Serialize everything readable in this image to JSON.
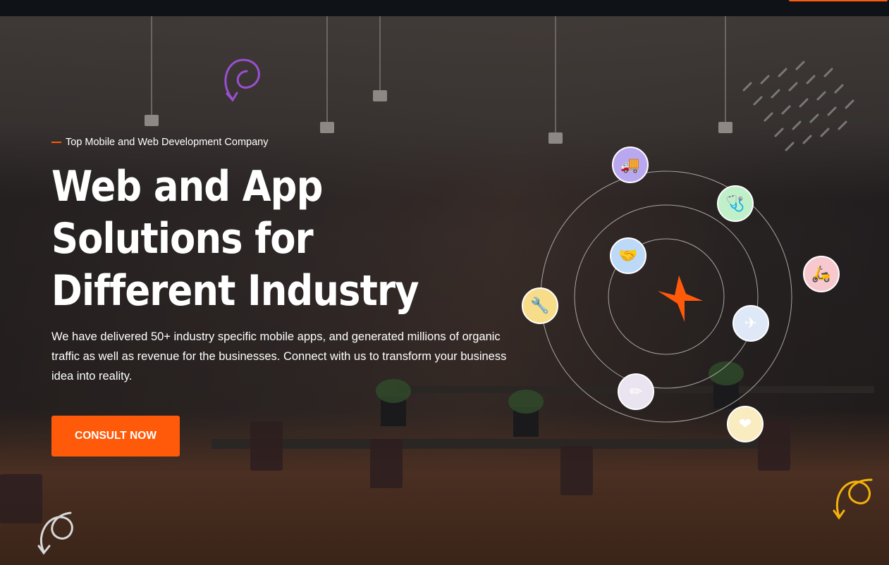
{
  "hero": {
    "eyebrow": "Top Mobile and Web Development Company",
    "title_lines": [
      "Web and App",
      "Solutions for",
      "Different Industry"
    ],
    "description": "We have delivered 50+ industry specific mobile apps, and generated millions of organic traffic as well as revenue for the businesses. Connect with us to transform your business idea into reality.",
    "cta_label": "CONSULT NOW"
  },
  "orbit": {
    "center_icon": "brand-x-icon",
    "items": [
      {
        "name": "logistics-icon",
        "glyph": "🚚",
        "bg": "#b9a8f0"
      },
      {
        "name": "healthcare-icon",
        "glyph": "🩺",
        "bg": "#bff0c9"
      },
      {
        "name": "handshake-icon",
        "glyph": "🤝",
        "bg": "#bcd9f7"
      },
      {
        "name": "food-delivery-icon",
        "glyph": "🛵",
        "bg": "#f7c9cf"
      },
      {
        "name": "engineering-icon",
        "glyph": "🔧",
        "bg": "#f7dd8a"
      },
      {
        "name": "travel-icon",
        "glyph": "✈",
        "bg": "#dfe8f7"
      },
      {
        "name": "education-icon",
        "glyph": "✏",
        "bg": "#e9e4ef"
      },
      {
        "name": "entertainment-icon",
        "glyph": "❤",
        "bg": "#f9ecc0"
      }
    ]
  },
  "colors": {
    "accent": "#ff5a0a",
    "purple_squiggle": "#9b4fd1",
    "yellow_squiggle": "#f3b20c"
  }
}
